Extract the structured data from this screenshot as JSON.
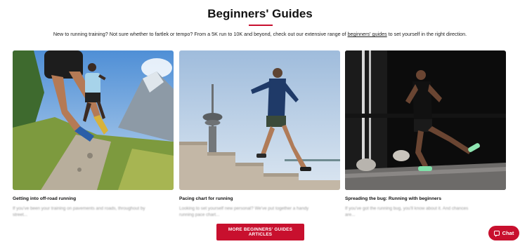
{
  "section": {
    "title": "Beginners' Guides",
    "intro_before": "New to running training? Not sure whether to fartlek or tempo? From a 5K run to 10K and beyond, check out our extensive range of ",
    "intro_link": "beginners' guides",
    "intro_after": " to set yourself in the right direction."
  },
  "cards": [
    {
      "title": "Getting into off-road running",
      "description": "If you've been your training on pavements and roads, throughout by street..."
    },
    {
      "title": "Pacing chart for running",
      "description": "Looking to set yourself new personal? We've put together a handy running pace chart..."
    },
    {
      "title": "Spreading the bug: Running with beginners",
      "description": "If you've got the running bug, you'll know about it. And chances are..."
    }
  ],
  "buttons": {
    "more": "MORE BEGINNERS' GUIDES ARTICLES",
    "chat": "Chat"
  },
  "colors": {
    "accent": "#c8102e"
  }
}
